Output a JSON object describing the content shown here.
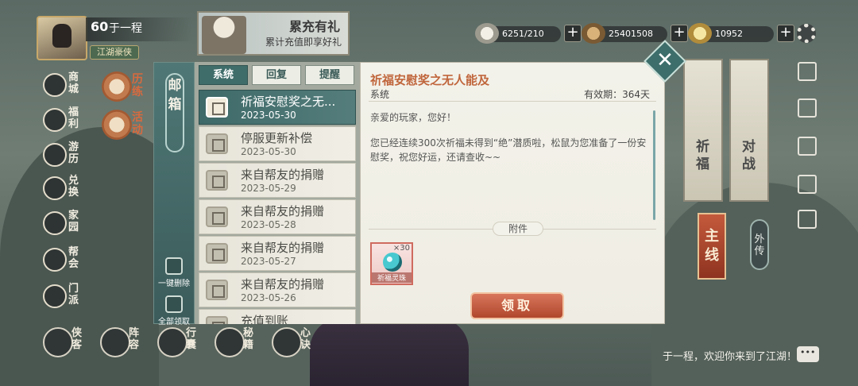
{
  "player": {
    "level": "60",
    "name": "于一程",
    "title": "江湖豪侠"
  },
  "banner": {
    "title": "累充有礼",
    "subtitle": "累计充值即享好礼"
  },
  "resources": [
    {
      "icon": "silver-icon",
      "value": "6251/210"
    },
    {
      "icon": "copper-icon",
      "value": "25401508"
    },
    {
      "icon": "gold-ingot-icon",
      "value": "10952"
    }
  ],
  "left_nav": [
    {
      "label": "商城",
      "icon": "shop-icon"
    },
    {
      "label": "福利",
      "icon": "welfare-icon"
    },
    {
      "label": "游历",
      "icon": "horse-icon"
    },
    {
      "label": "兑换",
      "icon": "exchange-icon"
    },
    {
      "label": "家园",
      "icon": "home-icon"
    },
    {
      "label": "帮会",
      "icon": "guild-icon"
    },
    {
      "label": "门派",
      "icon": "sect-icon"
    }
  ],
  "left_nav2": [
    {
      "label": "历练"
    },
    {
      "label": "活动"
    }
  ],
  "bottom_nav": [
    {
      "label": "侠客"
    },
    {
      "label": "阵容"
    },
    {
      "label": "行囊"
    },
    {
      "label": "秘籍"
    },
    {
      "label": "心诀"
    }
  ],
  "right_scrolls": [
    {
      "label": "祈福"
    },
    {
      "label": "对战"
    }
  ],
  "main_line": "主线",
  "side_story": "外传",
  "chat_text": "于一程，欢迎你来到了江湖！",
  "mail": {
    "panel_title": "邮箱",
    "tabs": [
      "系统",
      "回复",
      "提醒"
    ],
    "delete_all": "一键删除",
    "claim_all": "全部领取",
    "items": [
      {
        "title": "祈福安慰奖之无...",
        "date": "2023-05-30"
      },
      {
        "title": "停服更新补偿",
        "date": "2023-05-30"
      },
      {
        "title": "来自帮友的捐赠",
        "date": "2023-05-29"
      },
      {
        "title": "来自帮友的捐赠",
        "date": "2023-05-28"
      },
      {
        "title": "来自帮友的捐赠",
        "date": "2023-05-27"
      },
      {
        "title": "来自帮友的捐赠",
        "date": "2023-05-26"
      },
      {
        "title": "充值到账",
        "date": ""
      }
    ],
    "detail": {
      "title": "祈福安慰奖之无人能及",
      "sender": "系统",
      "validity": "有效期：364天",
      "greeting": "亲爱的玩家，您好！",
      "body": "您已经连续300次祈福未得到“绝”潜质啦，松鼠为您准备了一份安慰奖，祝您好运，还请查收~~",
      "attachment_label": "附件",
      "attachment": {
        "name": "祈福灵珠",
        "count": "×30"
      },
      "claim_button": "领取"
    }
  }
}
